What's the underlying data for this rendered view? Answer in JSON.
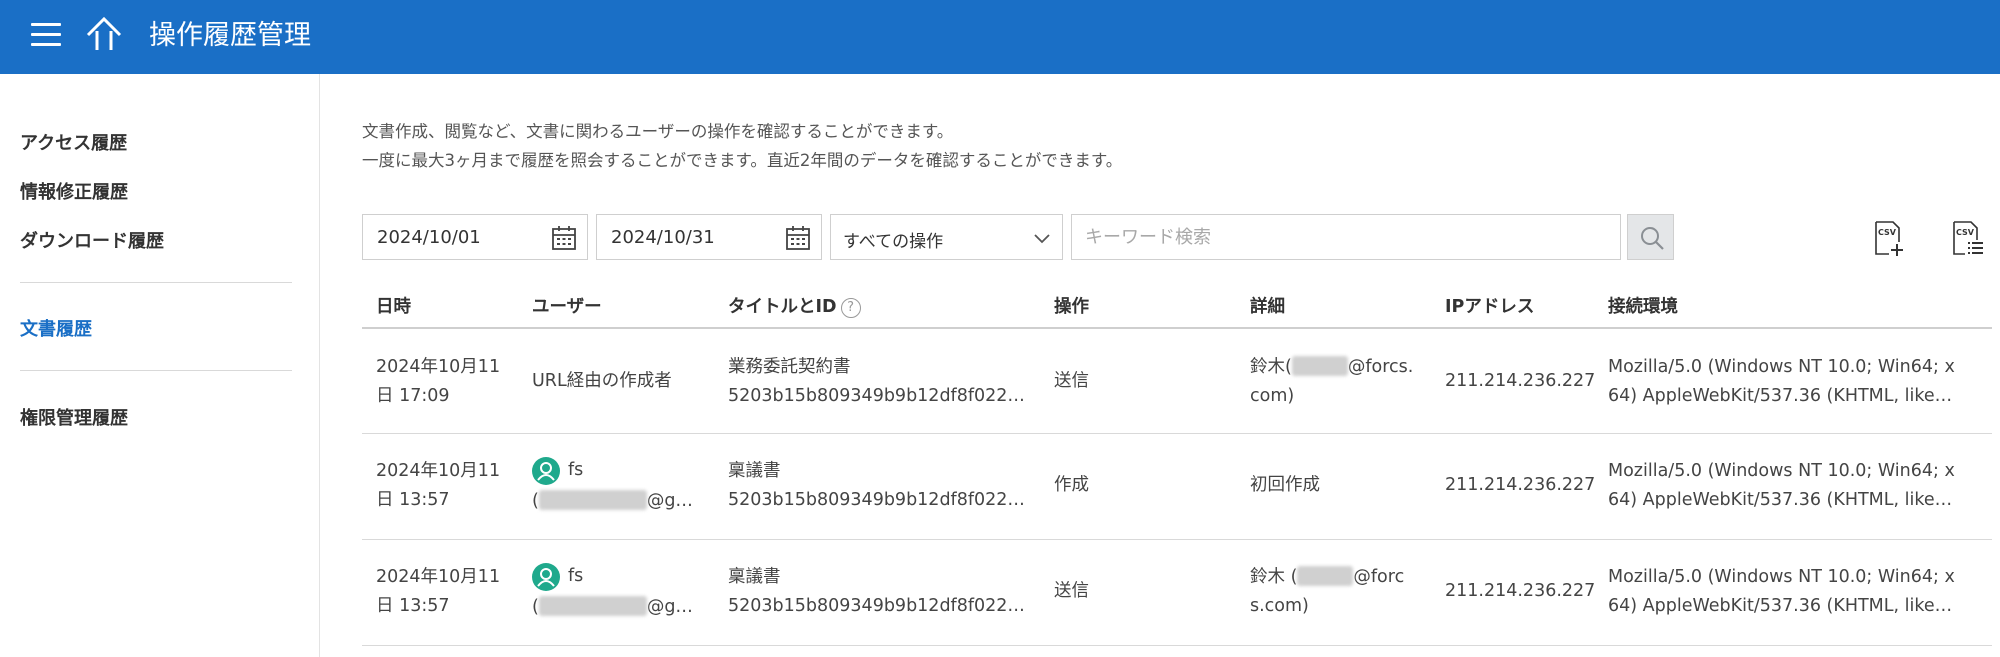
{
  "app": {
    "title": "操作履歴管理"
  },
  "sidebar": {
    "items": [
      {
        "label": "アクセス履歴"
      },
      {
        "label": "情報修正履歴"
      },
      {
        "label": "ダウンロード履歴"
      },
      {
        "label": "文書履歴",
        "active": true
      },
      {
        "label": "権限管理履歴"
      }
    ]
  },
  "description": {
    "line1": "文書作成、閲覧など、文書に関わるユーザーの操作を確認することができます。",
    "line2": "一度に最大3ヶ月まで履歴を照会することができます。直近2年間のデータを確認することができます。"
  },
  "filters": {
    "start_date": "2024/10/01",
    "end_date": "2024/10/31",
    "operation_select": "すべての操作",
    "search_placeholder": "キーワード検索",
    "search_value": ""
  },
  "table": {
    "headers": [
      "日時",
      "ユーザー",
      "タイトルとID",
      "操作",
      "詳細",
      "IPアドレス",
      "接続環境"
    ],
    "help_icon": "?",
    "rows": [
      {
        "date1": "2024年10月11",
        "date2": "日 17:09",
        "user": "URL経由の作成者",
        "title": "業務委託契約書",
        "id": "5203b15b809349b9b12df8f022…",
        "operation": "送信",
        "detail1_pre": "鈴木(",
        "detail1_post": "@forcs.",
        "detail2": "com)",
        "ip": "211.214.236.227",
        "env1": "Mozilla/5.0 (Windows NT 10.0; Win64; x",
        "env2": "64) AppleWebKit/537.36 (KHTML, like…"
      },
      {
        "date1": "2024年10月11",
        "date2": "日 13:57",
        "user_name": "fs",
        "user_email_pre": "(",
        "user_email_post": "@g…",
        "title": "稟議書",
        "id": "5203b15b809349b9b12df8f022…",
        "operation": "作成",
        "detail": "初回作成",
        "ip": "211.214.236.227",
        "env1": "Mozilla/5.0 (Windows NT 10.0; Win64; x",
        "env2": "64) AppleWebKit/537.36 (KHTML, like…"
      },
      {
        "date1": "2024年10月11",
        "date2": "日 13:57",
        "user_name": "fs",
        "user_email_pre": "(",
        "user_email_post": "@g…",
        "title": "稟議書",
        "id": "5203b15b809349b9b12df8f022…",
        "operation": "送信",
        "detail1_pre": "鈴木 (",
        "detail1_post": "@forc",
        "detail2": "s.com)",
        "ip": "211.214.236.227",
        "env1": "Mozilla/5.0 (Windows NT 10.0; Win64; x",
        "env2": "64) AppleWebKit/537.36 (KHTML, like…"
      }
    ]
  },
  "colors": {
    "header_bg": "#1a6fc6",
    "active_link": "#1a6fc6",
    "avatar": "#1fa98c"
  },
  "icons": [
    "menu-icon",
    "home-icon",
    "calendar-icon",
    "chevron-down-icon",
    "search-icon",
    "csv-add-icon",
    "csv-list-icon",
    "user-avatar-icon",
    "help-icon"
  ]
}
